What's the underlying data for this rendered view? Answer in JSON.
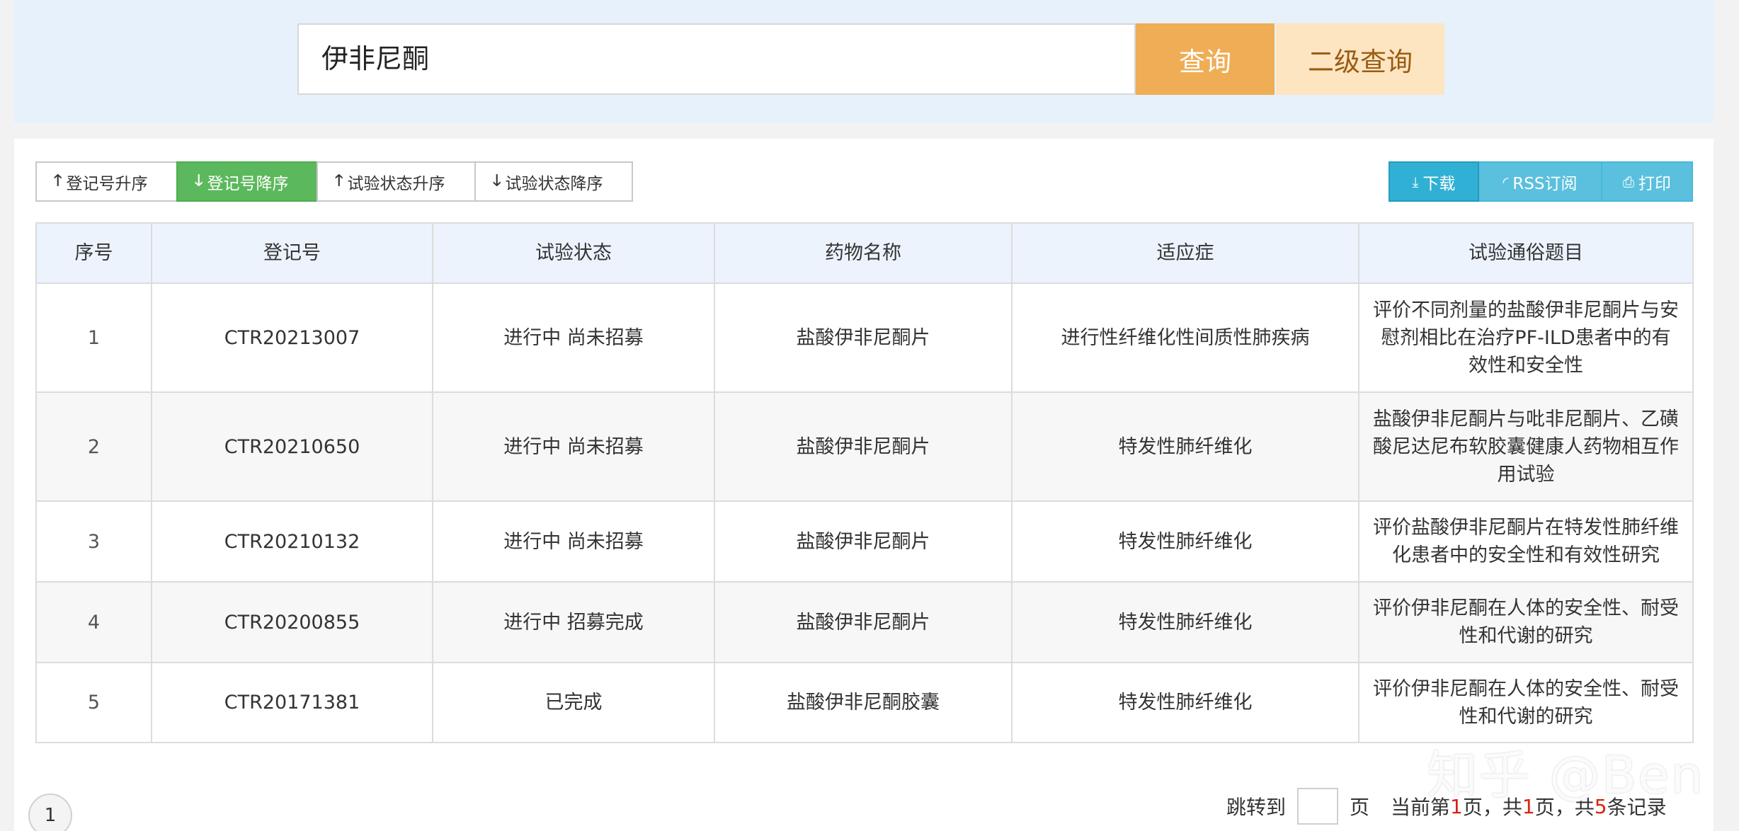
{
  "search": {
    "value": "伊非尼酮",
    "query_label": "查询",
    "secondary_query_label": "二级查询"
  },
  "sort_buttons": [
    {
      "label": "登记号升序",
      "icon": "arrow-up-icon",
      "active": false
    },
    {
      "label": "登记号降序",
      "icon": "arrow-down-icon",
      "active": true
    },
    {
      "label": "试验状态升序",
      "icon": "arrow-up-icon",
      "active": false
    },
    {
      "label": "试验状态降序",
      "icon": "arrow-down-icon",
      "active": false
    }
  ],
  "actions": {
    "download_label": "下载",
    "rss_label": "RSS订阅",
    "print_label": "打印"
  },
  "colors": {
    "query_button": "#efad55",
    "secondary_query_button": "#fde5c2",
    "active_sort": "#5cb85c",
    "action_button": "#5bc0de",
    "header_bg": "#ecf3fd",
    "highlight_number": "#d9230f"
  },
  "table": {
    "headers": [
      "序号",
      "登记号",
      "试验状态",
      "药物名称",
      "适应症",
      "试验通俗题目"
    ],
    "rows": [
      {
        "seq": "1",
        "reg_no": "CTR20213007",
        "status": "进行中 尚未招募",
        "drug": "盐酸伊非尼酮片",
        "indication": "进行性纤维化性间质性肺疾病",
        "title": "评价不同剂量的盐酸伊非尼酮片与安慰剂相比在治疗PF-ILD患者中的有效性和安全性"
      },
      {
        "seq": "2",
        "reg_no": "CTR20210650",
        "status": "进行中 尚未招募",
        "drug": "盐酸伊非尼酮片",
        "indication": "特发性肺纤维化",
        "title": "盐酸伊非尼酮片与吡非尼酮片、乙磺酸尼达尼布软胶囊健康人药物相互作用试验"
      },
      {
        "seq": "3",
        "reg_no": "CTR20210132",
        "status": "进行中 尚未招募",
        "drug": "盐酸伊非尼酮片",
        "indication": "特发性肺纤维化",
        "title": "评价盐酸伊非尼酮片在特发性肺纤维化患者中的安全性和有效性研究"
      },
      {
        "seq": "4",
        "reg_no": "CTR20200855",
        "status": "进行中 招募完成",
        "drug": "盐酸伊非尼酮片",
        "indication": "特发性肺纤维化",
        "title": "评价伊非尼酮在人体的安全性、耐受性和代谢的研究"
      },
      {
        "seq": "5",
        "reg_no": "CTR20171381",
        "status": "已完成",
        "drug": "盐酸伊非尼酮胶囊",
        "indication": "特发性肺纤维化",
        "title": "评价伊非尼酮在人体的安全性、耐受性和代谢的研究"
      }
    ]
  },
  "pagination": {
    "current_page_button": "1",
    "jump_label": "跳转到",
    "page_unit": "页",
    "current_prefix": "当前第",
    "current_page": "1",
    "current_suffix": "页，共",
    "total_pages": "1",
    "total_suffix": "页，共",
    "total_records": "5",
    "records_suffix": "条记录"
  },
  "watermark": "知乎 @Ben"
}
